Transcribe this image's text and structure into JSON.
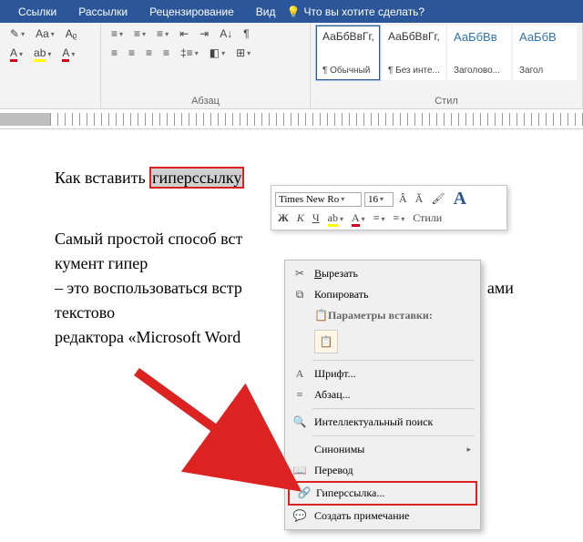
{
  "tabs": {
    "links": "Ссылки",
    "mailings": "Рассылки",
    "review": "Рецензирование",
    "view": "Вид",
    "tellme": "Что вы хотите сделать?"
  },
  "ribbon": {
    "paragraph_label": "Абзац",
    "styles_label": "Стил",
    "style_sample": "АаБбВвГг,",
    "style_sample_h": "АаБбВв",
    "style_sample_h2": "АаБбВ",
    "styles": {
      "normal": "¶ Обычный",
      "nospacing": "¶ Без инте...",
      "heading1": "Заголово...",
      "heading2": "Загол"
    },
    "font_A": "A",
    "Aa": "Aa"
  },
  "mini": {
    "font": "Times New Ro",
    "size": "16",
    "styles_label": "Стили",
    "B": "Ж",
    "I": "К",
    "U": "Ч"
  },
  "doc": {
    "title_before": "Как вставить ",
    "title_hl": "гиперссылку",
    "p_before": "Самый простой способ вст",
    "p_after": "кумент гипер",
    "p2_before": "– это воспользоваться встр",
    "p2_after": "ами текстово",
    "p3_before": "редактора «Microsoft Word"
  },
  "ctx": {
    "cut": "Вырезать",
    "copy": "Копировать",
    "paste_header": "Параметры вставки:",
    "font": "Шрифт...",
    "para": "Абзац...",
    "search": "Интеллектуальный поиск",
    "syn": "Синонимы",
    "translate": "Перевод",
    "hyperlink": "Гиперссылка...",
    "comment": "Создать примечание"
  }
}
